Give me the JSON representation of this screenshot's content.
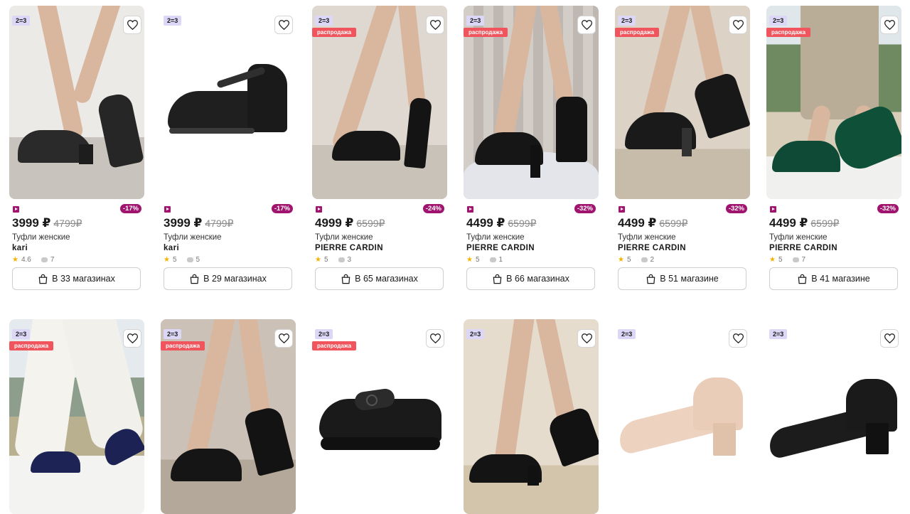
{
  "badges": {
    "promo": "2=3",
    "sale": "распродажа"
  },
  "cards": [
    {
      "price": "3999 ₽",
      "old_price": "4799₽",
      "discount": "-17%",
      "title": "Туфли женские",
      "brand": "kari",
      "rating": "4.6",
      "reviews": "7",
      "stores": "В 33 магазинах",
      "sale": false
    },
    {
      "price": "3999 ₽",
      "old_price": "4799₽",
      "discount": "-17%",
      "title": "Туфли женские",
      "brand": "kari",
      "rating": "5",
      "reviews": "5",
      "stores": "В 29 магазинах",
      "sale": false
    },
    {
      "price": "4999 ₽",
      "old_price": "6599₽",
      "discount": "-24%",
      "title": "Туфли женские",
      "brand": "PIERRE CARDIN",
      "rating": "5",
      "reviews": "3",
      "stores": "В 65 магазинах",
      "sale": true
    },
    {
      "price": "4499 ₽",
      "old_price": "6599₽",
      "discount": "-32%",
      "title": "Туфли женские",
      "brand": "PIERRE CARDIN",
      "rating": "5",
      "reviews": "1",
      "stores": "В 66 магазинах",
      "sale": true
    },
    {
      "price": "4499 ₽",
      "old_price": "6599₽",
      "discount": "-32%",
      "title": "Туфли женские",
      "brand": "PIERRE CARDIN",
      "rating": "5",
      "reviews": "2",
      "stores": "В 51 магазине",
      "sale": true
    },
    {
      "price": "4499 ₽",
      "old_price": "6599₽",
      "discount": "-32%",
      "title": "Туфли женские",
      "brand": "PIERRE CARDIN",
      "rating": "5",
      "reviews": "7",
      "stores": "В 41 магазине",
      "sale": true
    }
  ],
  "row2_sale": [
    true,
    true,
    true,
    false,
    false,
    false
  ],
  "icons": {
    "favorite": "heart-icon",
    "stores": "shopping-bag-icon",
    "rating": "star-icon",
    "reviews": "comment-icon",
    "video": "video-badge-icon"
  },
  "colors": {
    "accent": "#a0136f",
    "sale": "#f0555d",
    "promo": "#dcd7f7"
  }
}
